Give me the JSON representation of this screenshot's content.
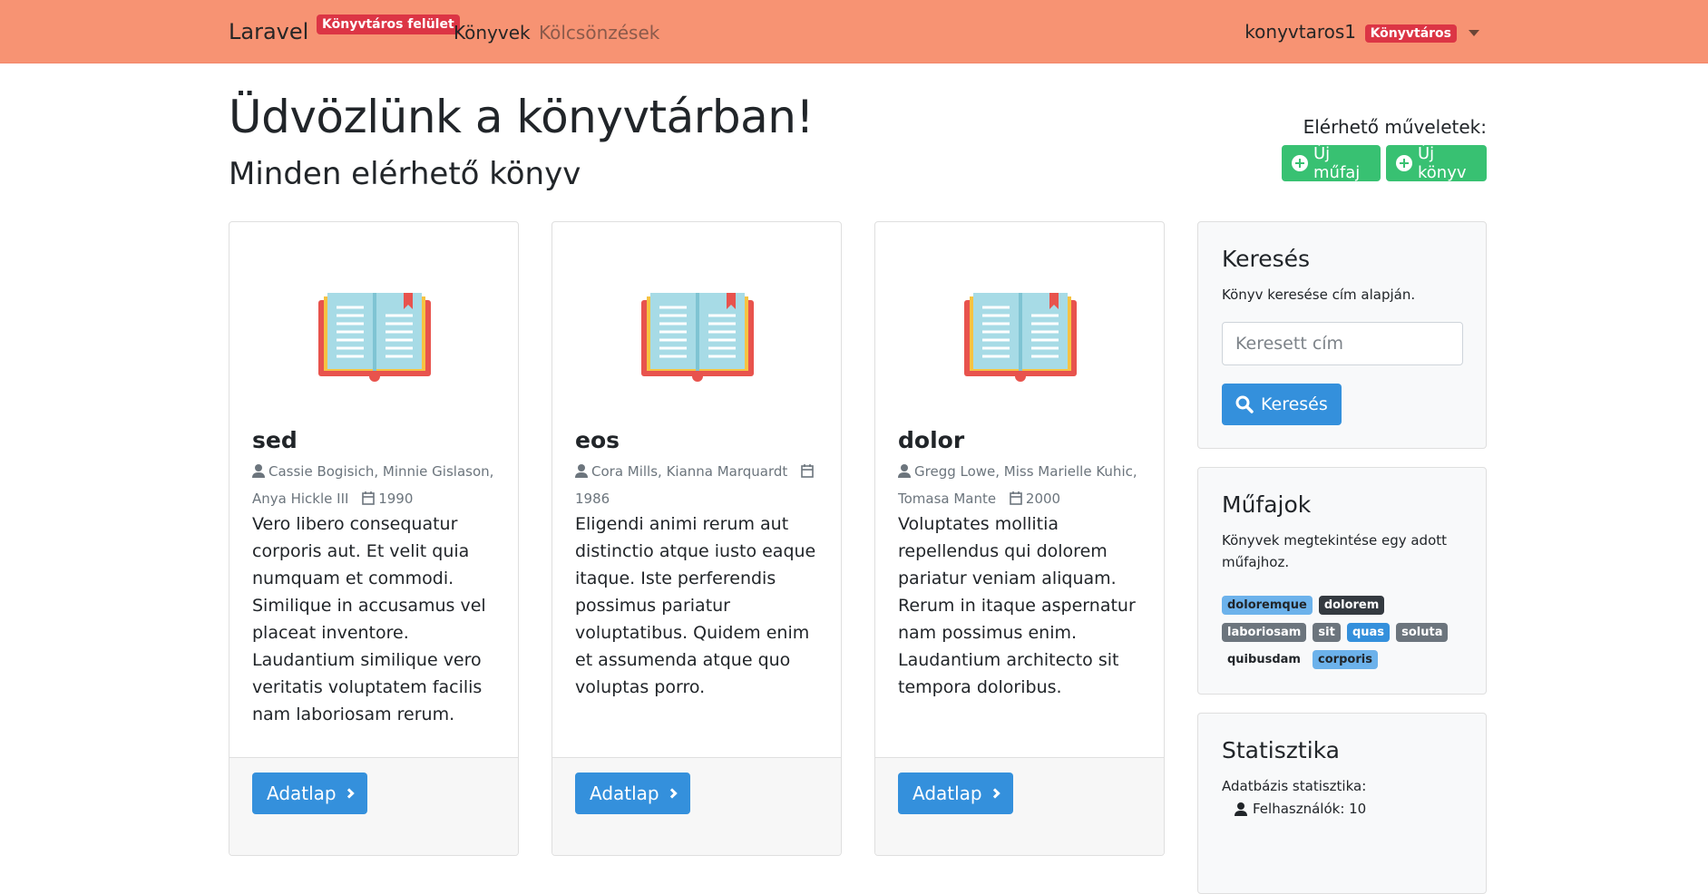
{
  "navbar": {
    "brand": "Laravel",
    "librarian_badge": "Könyvtáros felület",
    "links": [
      "Könyvek",
      "Kölcsönzések"
    ],
    "user_name": "konyvtaros1",
    "role_badge": "Könyvtáros"
  },
  "header": {
    "title": "Üdvözlünk a könyvtárban!",
    "subtitle": "Minden elérhető könyv",
    "actions_label": "Elérhető műveletek:",
    "new_genre": "Új műfaj",
    "new_book": "Új könyv"
  },
  "books": [
    {
      "title": "sed",
      "authors": "Cassie Bogisich, Minnie Gislason, Anya Hickle III",
      "year": "1990",
      "description": "Vero libero consequatur corporis aut. Et velit quia numquam et commodi. Similique in accusamus vel placeat inventore. Laudantium similique vero veritatis voluptatem facilis nam laboriosam rerum.",
      "button": "Adatlap"
    },
    {
      "title": "eos",
      "authors": "Cora Mills, Kianna Marquardt",
      "year": "1986",
      "description": "Eligendi animi rerum aut distinctio atque iusto eaque itaque. Iste perferendis possimus pariatur voluptatibus. Quidem enim et assumenda atque quo voluptas porro.",
      "button": "Adatlap"
    },
    {
      "title": "dolor",
      "authors": "Gregg Lowe, Miss Marielle Kuhic, Tomasa Mante",
      "year": "2000",
      "description": "Voluptates mollitia repellendus qui dolorem pariatur veniam aliquam. Rerum in itaque aspernatur nam possimus enim. Laudantium architecto sit tempora doloribus.",
      "button": "Adatlap"
    }
  ],
  "search": {
    "title": "Keresés",
    "description": "Könyv keresése cím alapján.",
    "placeholder": "Keresett cím",
    "button": "Keresés"
  },
  "genres": {
    "title": "Műfajok",
    "description": "Könyvek megtekintése egy adott műfajhoz.",
    "tags": [
      {
        "label": "doloremque",
        "style": "light"
      },
      {
        "label": "dolorem",
        "style": "dark"
      },
      {
        "label": "laboriosam",
        "style": "gray"
      },
      {
        "label": "sit",
        "style": "gray"
      },
      {
        "label": "quas",
        "style": "blue"
      },
      {
        "label": "soluta",
        "style": "gray"
      },
      {
        "label": "quibusdam",
        "style": "plain"
      },
      {
        "label": "corporis",
        "style": "light"
      }
    ]
  },
  "stats": {
    "title": "Statisztika",
    "description": "Adatbázis statisztika:",
    "users_line": "Felhasználók: 10"
  },
  "colors": {
    "navbar": "#f79373",
    "primary": "#3490dc",
    "success": "#38c172",
    "danger": "#dc3545"
  }
}
